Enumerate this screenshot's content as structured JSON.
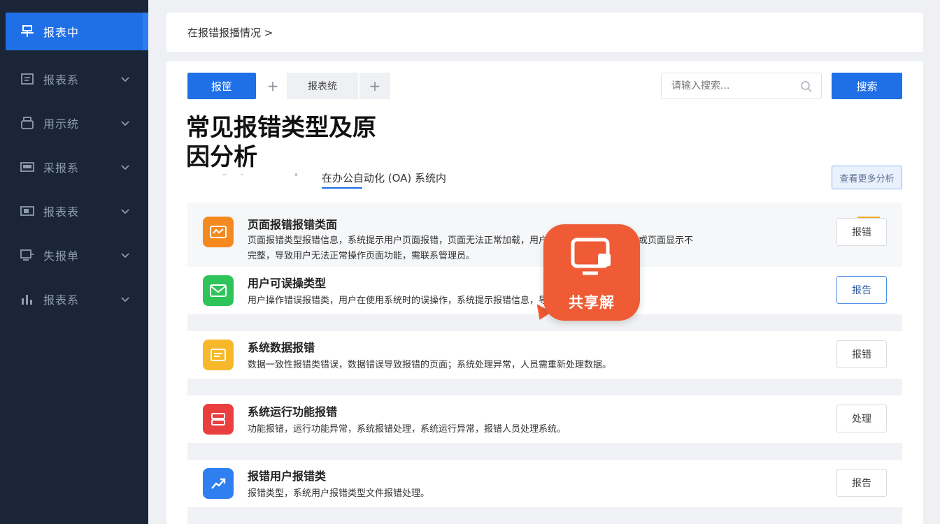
{
  "sidebar": {
    "items": [
      {
        "label": "报表中",
        "icon": "dashboard-icon",
        "active": true
      },
      {
        "label": "报表系",
        "icon": "report-icon"
      },
      {
        "label": "用示统",
        "icon": "printer-icon"
      },
      {
        "label": "采报系",
        "icon": "keyboard-icon"
      },
      {
        "label": "报表表",
        "icon": "monitor-icon"
      },
      {
        "label": "失报单",
        "icon": "device-icon"
      },
      {
        "label": "报表系",
        "icon": "chart-icon"
      }
    ]
  },
  "breadcrumb": "在报错报播情况 >",
  "toolbar": {
    "tab_primary": "报筐",
    "tab_secondary": "报表统",
    "search_placeholder": "请输入搜索...",
    "search_button": "搜索"
  },
  "content": {
    "title": "常见报错类型及原因分析",
    "subtab": "在办公自动化 (OA) 系统内",
    "top_action": "查看更多分析"
  },
  "rows": [
    {
      "title": "页面报错报错类面",
      "desc": "页面报错类型报错信息，系统提示用户页面报错，页面无法正常加载，用户需刷新页面重新加载，或页面显示不完整，导致用户无法正常操作页面功能，需联系管理员。",
      "action": "报错",
      "icon_color": "#f48a1f",
      "icon": "alert-icon"
    },
    {
      "title": "用户可误操类型",
      "desc": "用户操作错误报错类，用户在使用系统时的误操作，系统提示报错信息，导致操作失败。",
      "action": "报告",
      "icon_color": "#2fc45a",
      "icon": "mail-icon",
      "highlight": true
    },
    {
      "title": "系统数据报错",
      "desc": "数据一致性报错类错误，数据错误导致报错的页面；系统处理异常，人员需重新处理数据。",
      "action": "报错",
      "icon_color": "#f7b92b",
      "icon": "document-icon"
    },
    {
      "title": "系统运行功能报错",
      "desc": "功能报错，运行功能异常，系统报错处理，系统运行异常，报错人员处理系统。",
      "action": "处理",
      "icon_color": "#ea3f3f",
      "icon": "server-icon"
    },
    {
      "title": "报错用户报错类",
      "desc": "报错类型，系统用户报错类型文件报错处理。",
      "action": "报告",
      "icon_color": "#2f7ff0",
      "icon": "trend-icon"
    }
  ],
  "overlay": {
    "label": "共享解",
    "icon": "chat-monitor-icon",
    "color": "#ef5b35"
  }
}
